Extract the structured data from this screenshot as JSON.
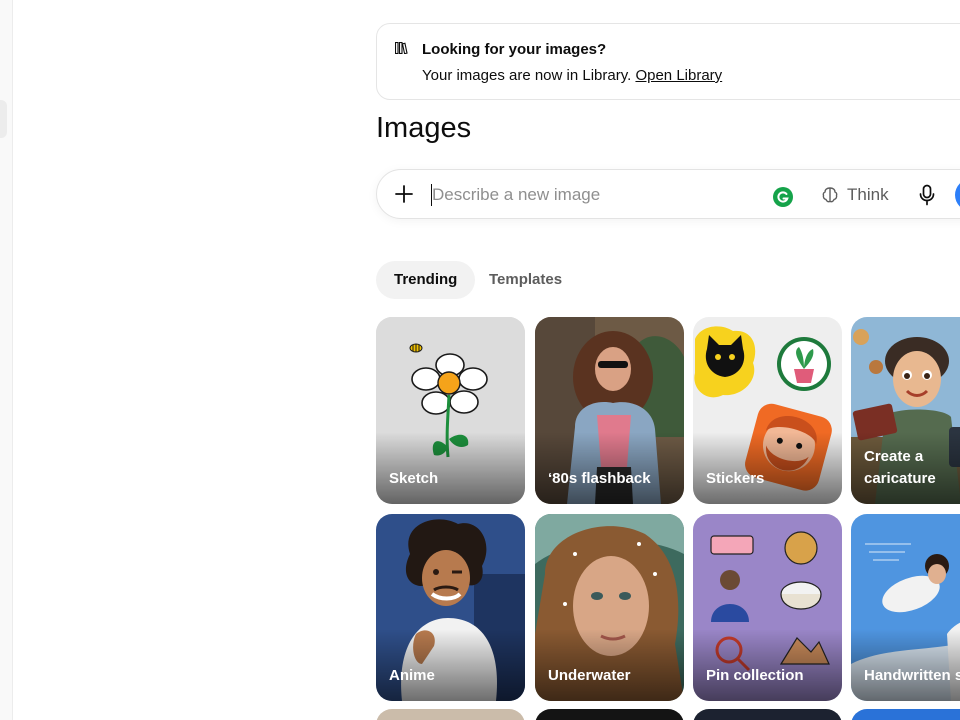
{
  "notice": {
    "icon": "library-icon",
    "title": "Looking for your images?",
    "body": "Your images are now in Library.",
    "link": "Open Library"
  },
  "page": {
    "title": "Images"
  },
  "composer": {
    "placeholder": "Describe a new image",
    "add_icon": "plus-icon",
    "extension_icon": "grammarly-icon",
    "think_label": "Think",
    "think_icon": "brain-icon",
    "mic_icon": "microphone-icon",
    "send_icon": "send-icon"
  },
  "tabs": [
    {
      "label": "Trending",
      "selected": true
    },
    {
      "label": "Templates",
      "selected": false
    }
  ],
  "cards": [
    {
      "label": "Sketch"
    },
    {
      "label": "‘80s flashback"
    },
    {
      "label": "Stickers"
    },
    {
      "label": "Create a caricature"
    },
    {
      "label": "Anime"
    },
    {
      "label": "Underwater"
    },
    {
      "label": "Pin collection"
    },
    {
      "label": "Handwritten s"
    }
  ],
  "colors": {
    "accent": "#2d7ff9",
    "grammarly": "#15a34a",
    "tab_active_bg": "#f2f2f2"
  }
}
